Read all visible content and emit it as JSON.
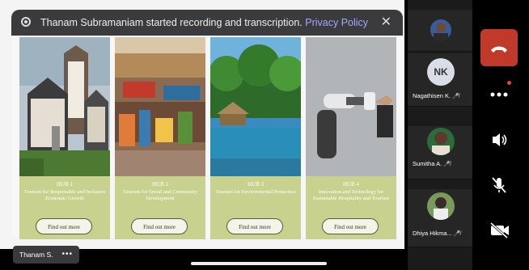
{
  "banner": {
    "message": "Thanam Subramaniam started recording and transcription.",
    "link": "Privacy Policy",
    "close_glyph": "✕"
  },
  "hubs": [
    {
      "number": "HUB 1",
      "title": "Tourism for Responsible and Inclusive Economic Growth",
      "button": "Find out more"
    },
    {
      "number": "HUB 2",
      "title": "Tourism for Social and Community Development",
      "button": "Find out more"
    },
    {
      "number": "HUB 3",
      "title": "Tourism for Environmental Protection",
      "button": "Find out more"
    },
    {
      "number": "HUB 4",
      "title": "Innovation and Technology for Sustainable Hospitality and Tourism",
      "button": "Find out more"
    }
  ],
  "presenter": {
    "name": "Thanam S.",
    "more": "•••"
  },
  "participants": [
    {
      "label": "",
      "initials": ""
    },
    {
      "label": "Nagathisen K.",
      "initials": "NK"
    },
    {
      "label": "Sumitha A.",
      "initials": ""
    },
    {
      "label": "Dhiya Hikma...",
      "initials": ""
    }
  ],
  "controls": {
    "end_icon": "phone-end-icon",
    "more_icon": "more-icon",
    "speaker_icon": "speaker-icon",
    "mic_icon": "mic-off-icon",
    "video_icon": "video-off-icon"
  },
  "colors": {
    "hub_card": "#c8d28e",
    "end_call": "#c0392b",
    "banner": "#3b3b3d",
    "link": "#a0a8ff"
  }
}
